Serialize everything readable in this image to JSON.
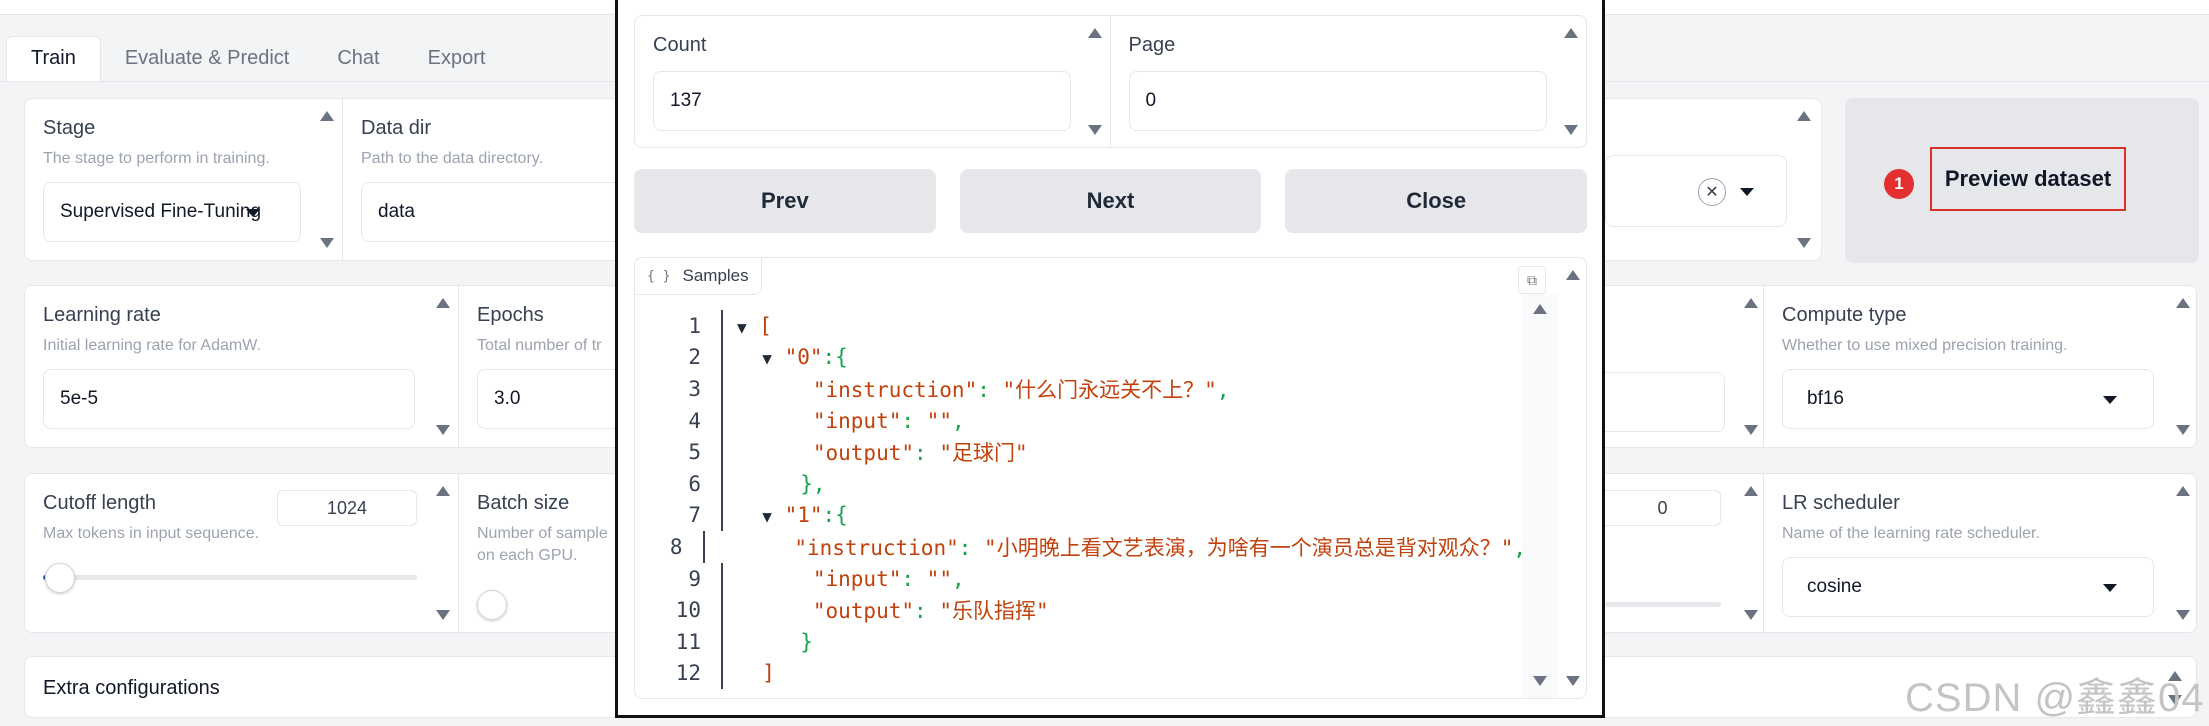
{
  "tabs": [
    "Train",
    "Evaluate & Predict",
    "Chat",
    "Export"
  ],
  "row1": {
    "stage": {
      "label": "Stage",
      "info": "The stage to perform in training.",
      "value": "Supervised Fine-Tuning"
    },
    "data_dir": {
      "label": "Data dir",
      "info": "Path to the data directory.",
      "value": "data"
    }
  },
  "preview": {
    "badge": "1",
    "label": "Preview dataset"
  },
  "row2": {
    "learning_rate": {
      "label": "Learning rate",
      "info": "Initial learning rate for AdamW.",
      "value": "5e-5"
    },
    "epochs": {
      "label": "Epochs",
      "info": "Total number of tr",
      "value": "3.0"
    },
    "compute_type": {
      "label": "Compute type",
      "info": "Whether to use mixed precision training.",
      "value": "bf16"
    }
  },
  "row3": {
    "cutoff": {
      "label": "Cutoff length",
      "info": "Max tokens in input sequence.",
      "value": "1024",
      "fill": 0.02
    },
    "batch": {
      "label": "Batch size",
      "info_line1": "Number of sample",
      "info_line2": "on each GPU."
    },
    "partial_value": "0",
    "lr_scheduler": {
      "label": "LR scheduler",
      "info": "Name of the learning rate scheduler.",
      "value": "cosine"
    }
  },
  "extra": {
    "label": "Extra configurations"
  },
  "modal": {
    "count": {
      "label": "Count",
      "value": "137"
    },
    "page": {
      "label": "Page",
      "value": "0"
    },
    "buttons": {
      "prev": "Prev",
      "next": "Next",
      "close": "Close"
    },
    "samples_label": "Samples",
    "samples_icon": "{ }",
    "line_numbers": [
      "1",
      "2",
      "3",
      "4",
      "5",
      "6",
      "7",
      "8",
      "9",
      "10",
      "11",
      "12"
    ],
    "json": {
      "key0": "\"0\"",
      "key1": "\"1\"",
      "instruction_key": "\"instruction\"",
      "input_key": "\"input\"",
      "output_key": "\"output\"",
      "instr0": "\"什么门永远关不上？\"",
      "input0": "\"\"",
      "output0": "\"足球门\"",
      "instr1": "\"小明晚上看文艺表演，为啥有一个演员总是背对观众？\"",
      "input1": "\"\"",
      "output1": "\"乐队指挥\""
    }
  },
  "watermark": "CSDN @鑫鑫04",
  "colors": {
    "accent_red": "#e3302f",
    "code_string": "#c2410c"
  }
}
